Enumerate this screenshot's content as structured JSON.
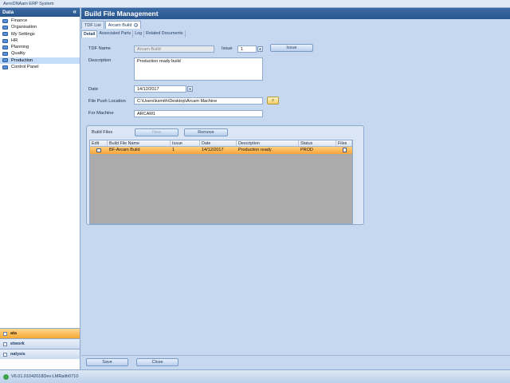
{
  "app": {
    "title": "AeroDNAam ERP System"
  },
  "sidebar": {
    "header": "Data",
    "collapse_glyph": "«",
    "items": [
      {
        "label": "Finance",
        "icon": "folder-icon"
      },
      {
        "label": "Organisation",
        "icon": "folder-icon"
      },
      {
        "label": "My Settings",
        "icon": "folder-icon"
      },
      {
        "label": "HR",
        "icon": "folder-icon"
      },
      {
        "label": "Planning",
        "icon": "folder-icon"
      },
      {
        "label": "Quality",
        "icon": "folder-icon"
      },
      {
        "label": "Production",
        "icon": "folder-icon",
        "active": true
      },
      {
        "label": "Control Panel",
        "icon": "folder-icon"
      }
    ],
    "panes": [
      {
        "label": "ata",
        "selected": true
      },
      {
        "label": "etwork",
        "selected": false
      },
      {
        "label": "nalysis",
        "selected": false
      }
    ]
  },
  "header": {
    "title": "Build File Management"
  },
  "tabs": [
    {
      "label": "TDF List",
      "active": false
    },
    {
      "label": "Arcam Build",
      "active": true,
      "closable": true
    }
  ],
  "subtabs": [
    {
      "label": "Detail",
      "active": true
    },
    {
      "label": "Associated Parts",
      "active": false
    },
    {
      "label": "Log",
      "active": false
    },
    {
      "label": "Related Documents",
      "active": false
    }
  ],
  "form": {
    "tdf_name_label": "TDF Name",
    "tdf_name_value": "Arcam Build",
    "issue_label": "Issue",
    "issue_value": "1",
    "issue_button": "Issue",
    "description_label": "Description",
    "description_value": "Production ready build",
    "date_label": "Date",
    "date_value": "14/12/2017",
    "path_label": "File Push Location",
    "path_value": "C:\\Users\\ksmith\\Desktop\\Arcam Machine",
    "machine_label": "For Machine",
    "machine_value": "ARCAM1"
  },
  "build_files": {
    "group_label": "Build Files",
    "new_button": "New",
    "remove_button": "Remove",
    "columns": [
      "Edit",
      "Build File Name",
      "Issue",
      "Date",
      "Description",
      "Status",
      "Files"
    ],
    "rows": [
      {
        "name": "BF-Arcam Build",
        "issue": "1",
        "date": "14/12/2017",
        "description": "Production ready",
        "status": "PROD"
      }
    ]
  },
  "footer": {
    "save": "Save",
    "close": "Close"
  },
  "status": {
    "version": "V6.01.01042018Dev:LMRaith0710"
  }
}
